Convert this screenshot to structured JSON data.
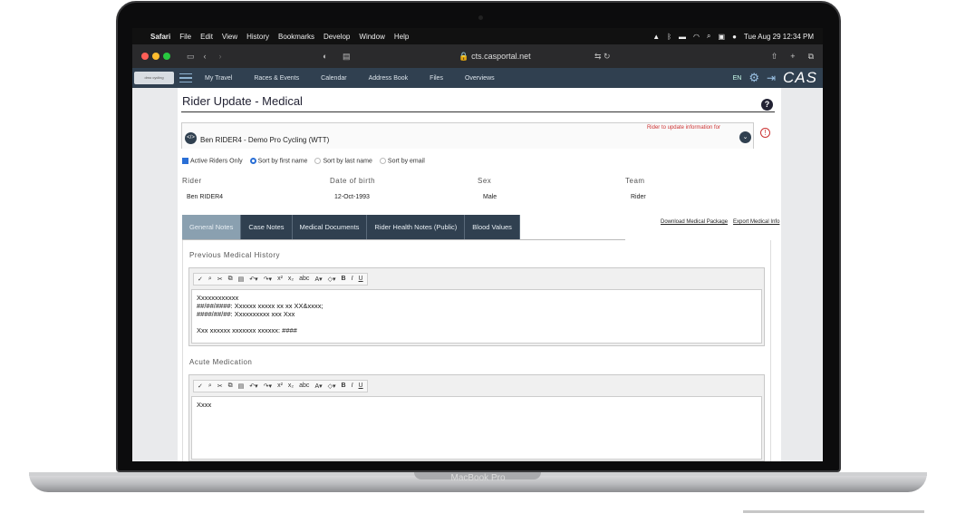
{
  "menubar": {
    "app": "Safari",
    "items": [
      "File",
      "Edit",
      "View",
      "History",
      "Bookmarks",
      "Develop",
      "Window",
      "Help"
    ],
    "datetime": "Tue Aug 29  12:34 PM"
  },
  "browser": {
    "url": "cts.casportal.net"
  },
  "appnav": {
    "logo": "dmo cycling",
    "items": [
      "My Travel",
      "Races & Events",
      "Calendar",
      "Address Book",
      "Files",
      "Overviews"
    ],
    "lang": "EN",
    "brand": "CAS"
  },
  "page": {
    "title": "Rider Update - Medical",
    "rider_name": "Ben RIDER4 - Demo Pro Cycling (WTT)",
    "hint": "Rider to update information for",
    "filters": {
      "active_only": "Active Riders Only",
      "sort_first": "Sort by first name",
      "sort_last": "Sort by last name",
      "sort_email": "Sort by email"
    },
    "headers": [
      "Rider",
      "Date of birth",
      "Sex",
      "Team"
    ],
    "values": [
      "Ben RIDER4",
      "12-Oct-1993",
      "Male",
      "Rider"
    ],
    "tabs": [
      "General Notes",
      "Case Notes",
      "Medical Documents",
      "Rider Health Notes (Public)",
      "Blood Values"
    ],
    "links": [
      "Download Medical Package",
      "Export Medical Info"
    ],
    "sections": [
      {
        "label": "Previous Medical History",
        "lines": [
          "Xxxxxxxxxxxx",
          "##/##/####: Xxxxxx xxxxx xx xx XX&xxxx;",
          "####/##/##: Xxxxxxxxxx xxx Xxx",
          "",
          "Xxx xxxxxx xxxxxxx xxxxxx: ####"
        ]
      },
      {
        "label": "Acute Medication",
        "lines": [
          "Xxxx"
        ]
      }
    ]
  },
  "laptop_label": "MacBook Pro"
}
